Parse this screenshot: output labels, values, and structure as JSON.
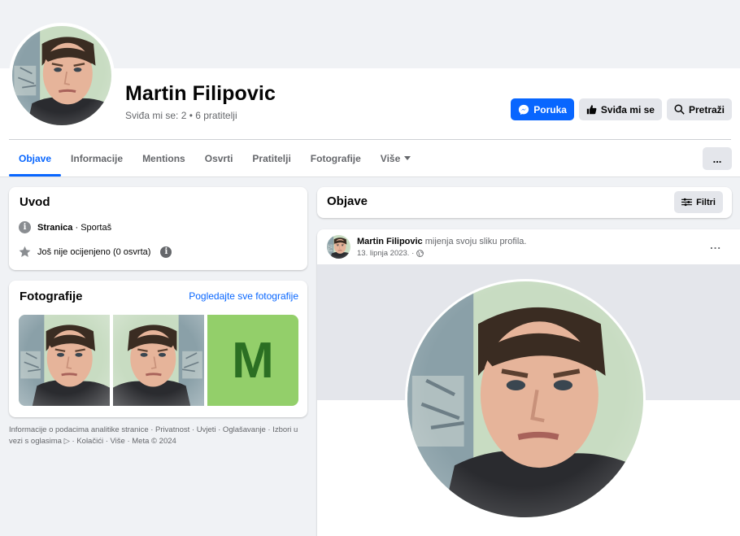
{
  "profile": {
    "name": "Martin Filipovic",
    "likes_label": "Sviđa mi se: 2",
    "followers_label": "6 pratitelji",
    "meta_separator": " • "
  },
  "actions": {
    "message": "Poruka",
    "like": "Sviđa mi se",
    "search": "Pretraži"
  },
  "tabs": [
    {
      "label": "Objave",
      "active": true
    },
    {
      "label": "Informacije"
    },
    {
      "label": "Mentions"
    },
    {
      "label": "Osvrti"
    },
    {
      "label": "Pratitelji"
    },
    {
      "label": "Fotografije"
    },
    {
      "label": "Više"
    }
  ],
  "more_button": "...",
  "intro": {
    "title": "Uvod",
    "category_prefix": "Stranica",
    "category_suffix": " · Sportaš",
    "rating": "Još nije ocijenjeno (0 osvrta)"
  },
  "photos": {
    "title": "Fotografije",
    "see_all": "Pogledajte sve fotografije",
    "monogram": "M"
  },
  "footer": "Informacije o podacima analitike stranice · Privatnost · Uvjeti · Oglašavanje · Izbori u vezi s oglasima ▷ · Kolačići · Više · Meta © 2024",
  "posts_header": {
    "title": "Objave",
    "filter": "Filtri"
  },
  "post": {
    "author": "Martin Filipovic",
    "action": " mijenja svoju sliku profila.",
    "date": "13. lipnja 2023. ·",
    "more": "..."
  },
  "colors": {
    "accent": "#0866ff",
    "background": "#f0f2f5",
    "tile_green": "#93cf6a"
  }
}
